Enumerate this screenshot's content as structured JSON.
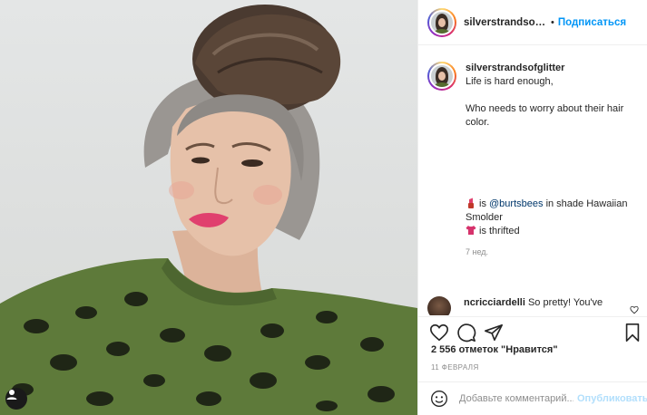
{
  "post": {
    "username": "silverstrandsofglitter",
    "header_username": "silverstrandsofglittе",
    "separator": "•",
    "follow_label": "Подписаться",
    "caption": {
      "line1": "Life is hard enough,",
      "line2": "Who needs to worry about their hair",
      "line3": "color.",
      "line4_prefix": "is",
      "line4_mention": "@burtsbees",
      "line4_suffix": "in shade Hawaiian",
      "line5": "Smolder",
      "line6": "is thrifted",
      "icons": [
        "lipstick-icon",
        "tshirt-icon"
      ]
    },
    "caption_time": "7 нед.",
    "top_comment": {
      "username": "ncricciardelli",
      "text": "So pretty! You've"
    },
    "likes_text": "2 556 отметок \"Нравится\"",
    "date_text": "11 ФЕВРАЛЯ",
    "comment_placeholder": "Добавьте комментарий...",
    "publish_label": "Опубликовать"
  },
  "icons": {
    "actions": [
      "heart-icon",
      "comment-icon",
      "share-icon",
      "bookmark-icon"
    ],
    "emoji": "smiley-icon",
    "user_tag": "user-tag-icon"
  },
  "colors": {
    "link_blue": "#0095f6",
    "publish_disabled": "#b2dffc",
    "mention": "#00376b",
    "muted": "#8e8e8e",
    "sweater_green": "#5e7a3a"
  }
}
